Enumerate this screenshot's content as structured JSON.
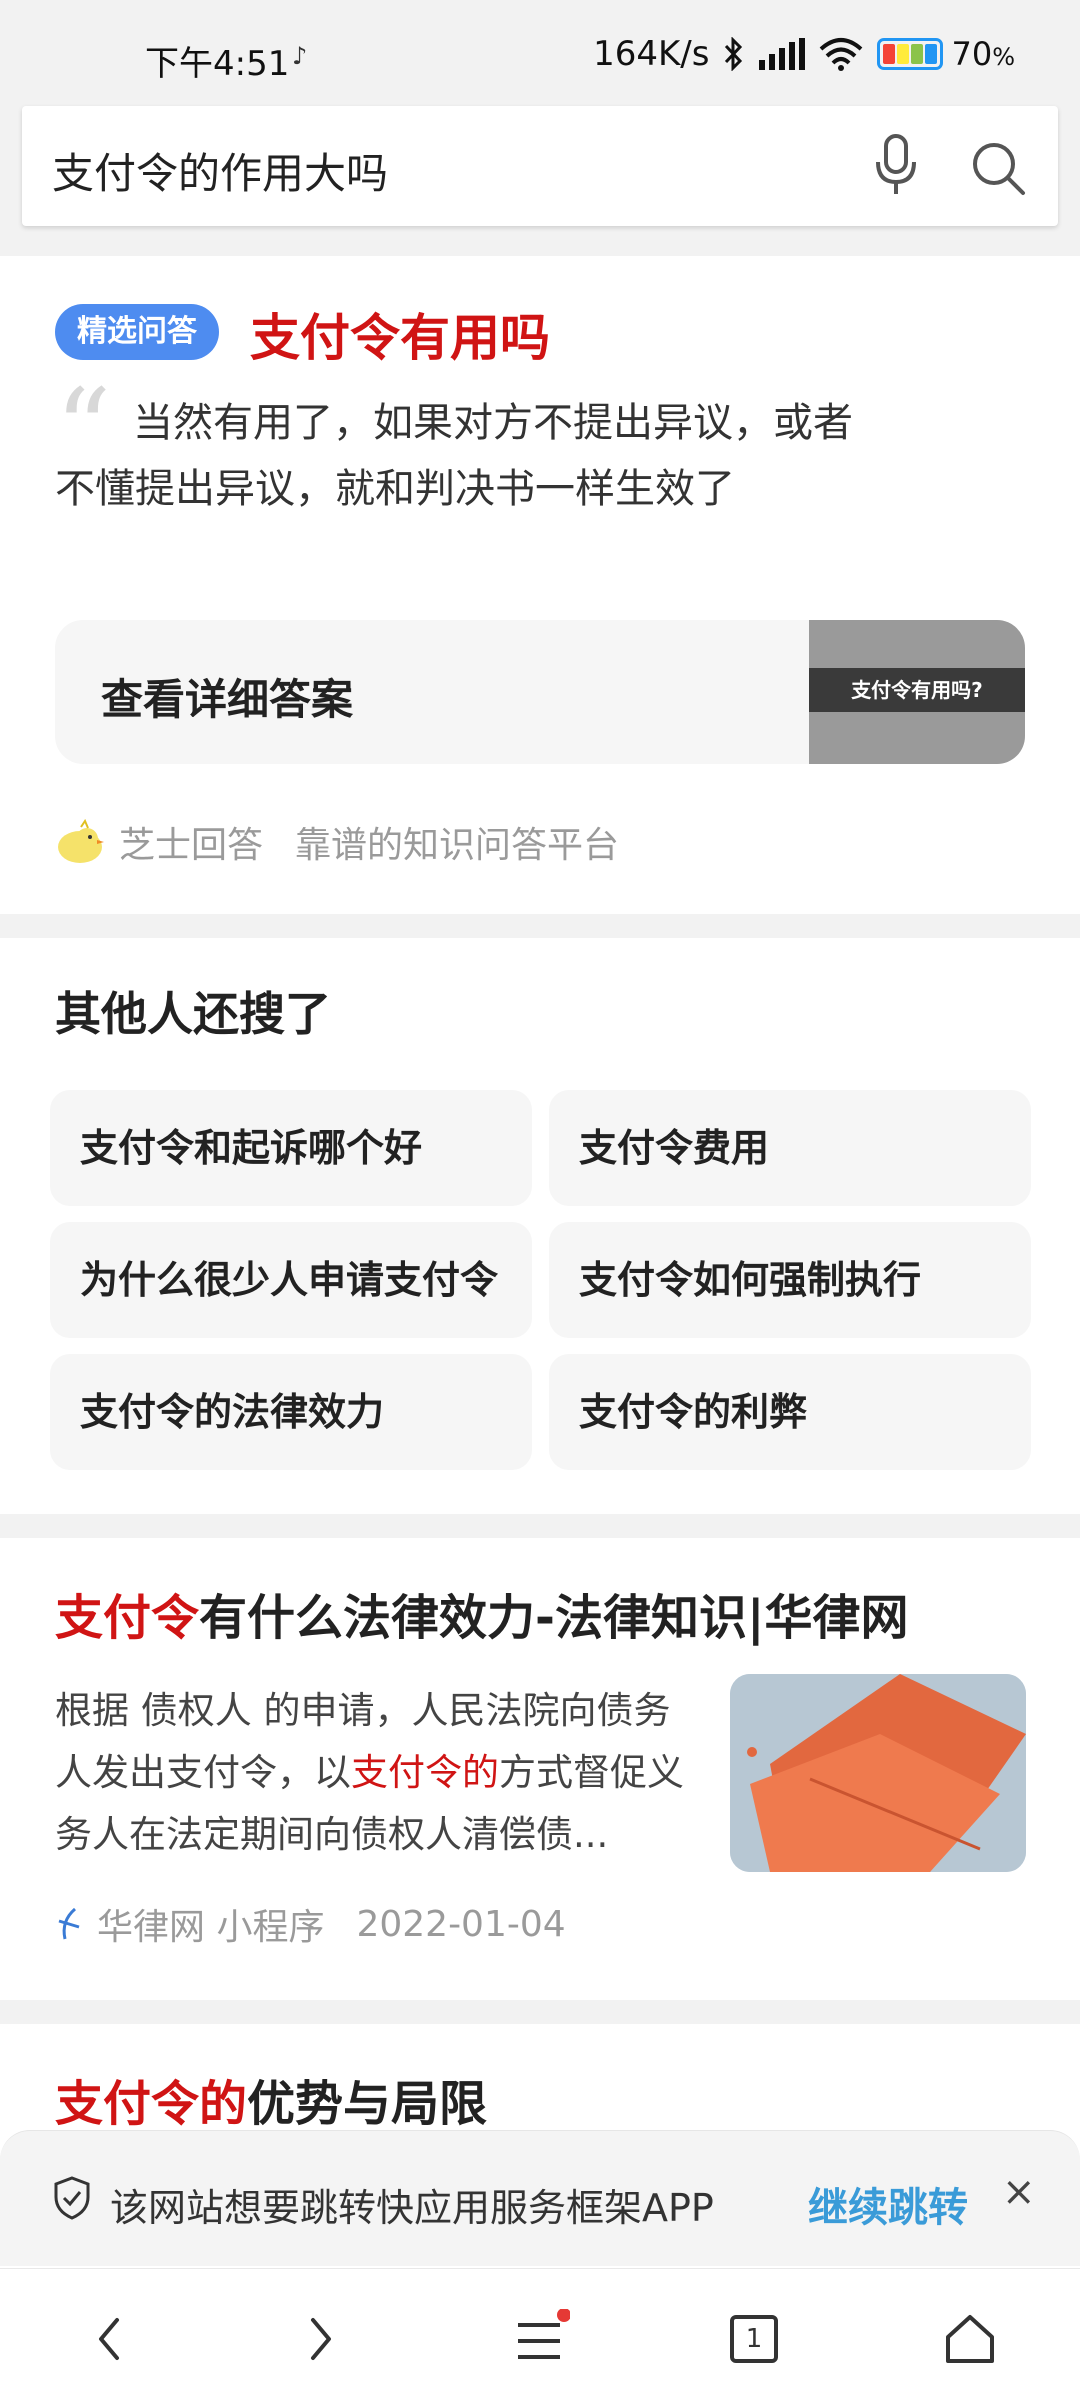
{
  "status_bar": {
    "time": "下午4:51",
    "net_speed": "164K/s",
    "battery_percent": "70",
    "battery_pct_symbol": "%",
    "tiktok_icon": "tiktok-icon",
    "bluetooth_icon": "bluetooth-icon",
    "signal_icon": "signal-icon",
    "wifi_icon": "wifi-icon",
    "battery_colors": [
      "#f44336",
      "#ffeb3b",
      "#8bc34a",
      "#2196f3"
    ]
  },
  "search": {
    "query": "支付令的作用大吗",
    "mic_icon": "mic-icon",
    "search_icon": "search-icon"
  },
  "featured_qa": {
    "badge": "精选问答",
    "title": "支付令有用吗",
    "answer": "当然有用了，如果对方不提出异议，或者不懂提出异议，就和判决书一样生效了",
    "detail_button": "查看详细答案",
    "detail_thumb_text": "支付令有用吗?",
    "source_name": "芝士回答",
    "source_desc": "靠谱的知识问答平台",
    "accent_color": "#d01414",
    "badge_color": "#4e8cf0"
  },
  "related_searches": {
    "title": "其他人还搜了",
    "items": [
      "支付令和起诉哪个好",
      "支付令费用",
      "为什么很少人申请支付令",
      "支付令如何强制执行",
      "支付令的法律效力",
      "支付令的利弊"
    ]
  },
  "results": [
    {
      "title_hl": "支付令",
      "title_rest": "有什么法律效力-法律知识|华律网",
      "snippet_pre": "根据 债权人 的申请，人民法院向债务人发出支付令，以",
      "snippet_hl": "支付令的",
      "snippet_post": "方式督促义务人在法定期间向债权人清偿债...",
      "source": "华律网 小程序",
      "date": "2022-01-04"
    },
    {
      "title_hl": "支付令的",
      "title_rest": "优势与局限"
    }
  ],
  "banner": {
    "text": "该网站想要跳转快应用服务框架APP",
    "action": "继续跳转",
    "close": "×",
    "action_color": "#3a9bd8"
  },
  "bottom_nav": {
    "back_icon": "back-arrow-icon",
    "forward_icon": "forward-arrow-icon",
    "menu_icon": "menu-icon",
    "tabs_count": "1",
    "home_icon": "home-icon"
  }
}
